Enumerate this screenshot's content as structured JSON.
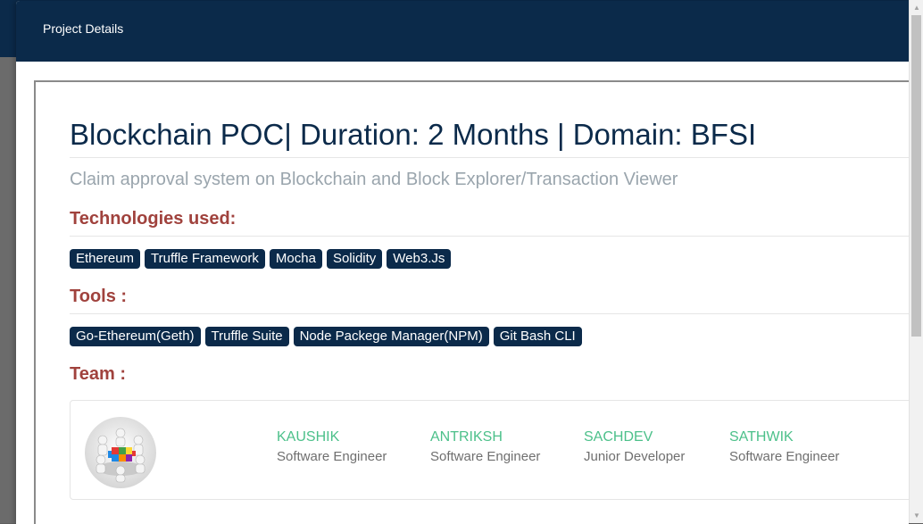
{
  "modal": {
    "title": "Project Details"
  },
  "project": {
    "title": "Blockchain POC| Duration: 2 Months | Domain: BFSI",
    "subtitle": "Claim approval system on Blockchain and Block Explorer/Transaction Viewer"
  },
  "technologies": {
    "heading": "Technologies used:",
    "items": [
      "Ethereum",
      "Truffle Framework",
      "Mocha",
      "Solidity",
      "Web3.Js"
    ]
  },
  "tools": {
    "heading": "Tools :",
    "items": [
      "Go-Ethereum(Geth)",
      "Truffle Suite",
      "Node Packege Manager(NPM)",
      "Git Bash CLI"
    ]
  },
  "team": {
    "heading": "Team :",
    "avatar_icon": "team-puzzle-icon",
    "members": [
      {
        "name": "KAUSHIK",
        "role": "Software Engineer"
      },
      {
        "name": "ANTRIKSH",
        "role": "Software Engineer"
      },
      {
        "name": "SACHDEV",
        "role": "Junior Developer"
      },
      {
        "name": "SATHWIK",
        "role": "Software Engineer"
      }
    ]
  },
  "colors": {
    "header_bg": "#0b2a4a",
    "title_text": "#0b2a4a",
    "section_heading": "#a0423d",
    "subtitle_text": "#9aa5ad",
    "tag_bg": "#0b2a4a",
    "member_name": "#4cc08a"
  }
}
